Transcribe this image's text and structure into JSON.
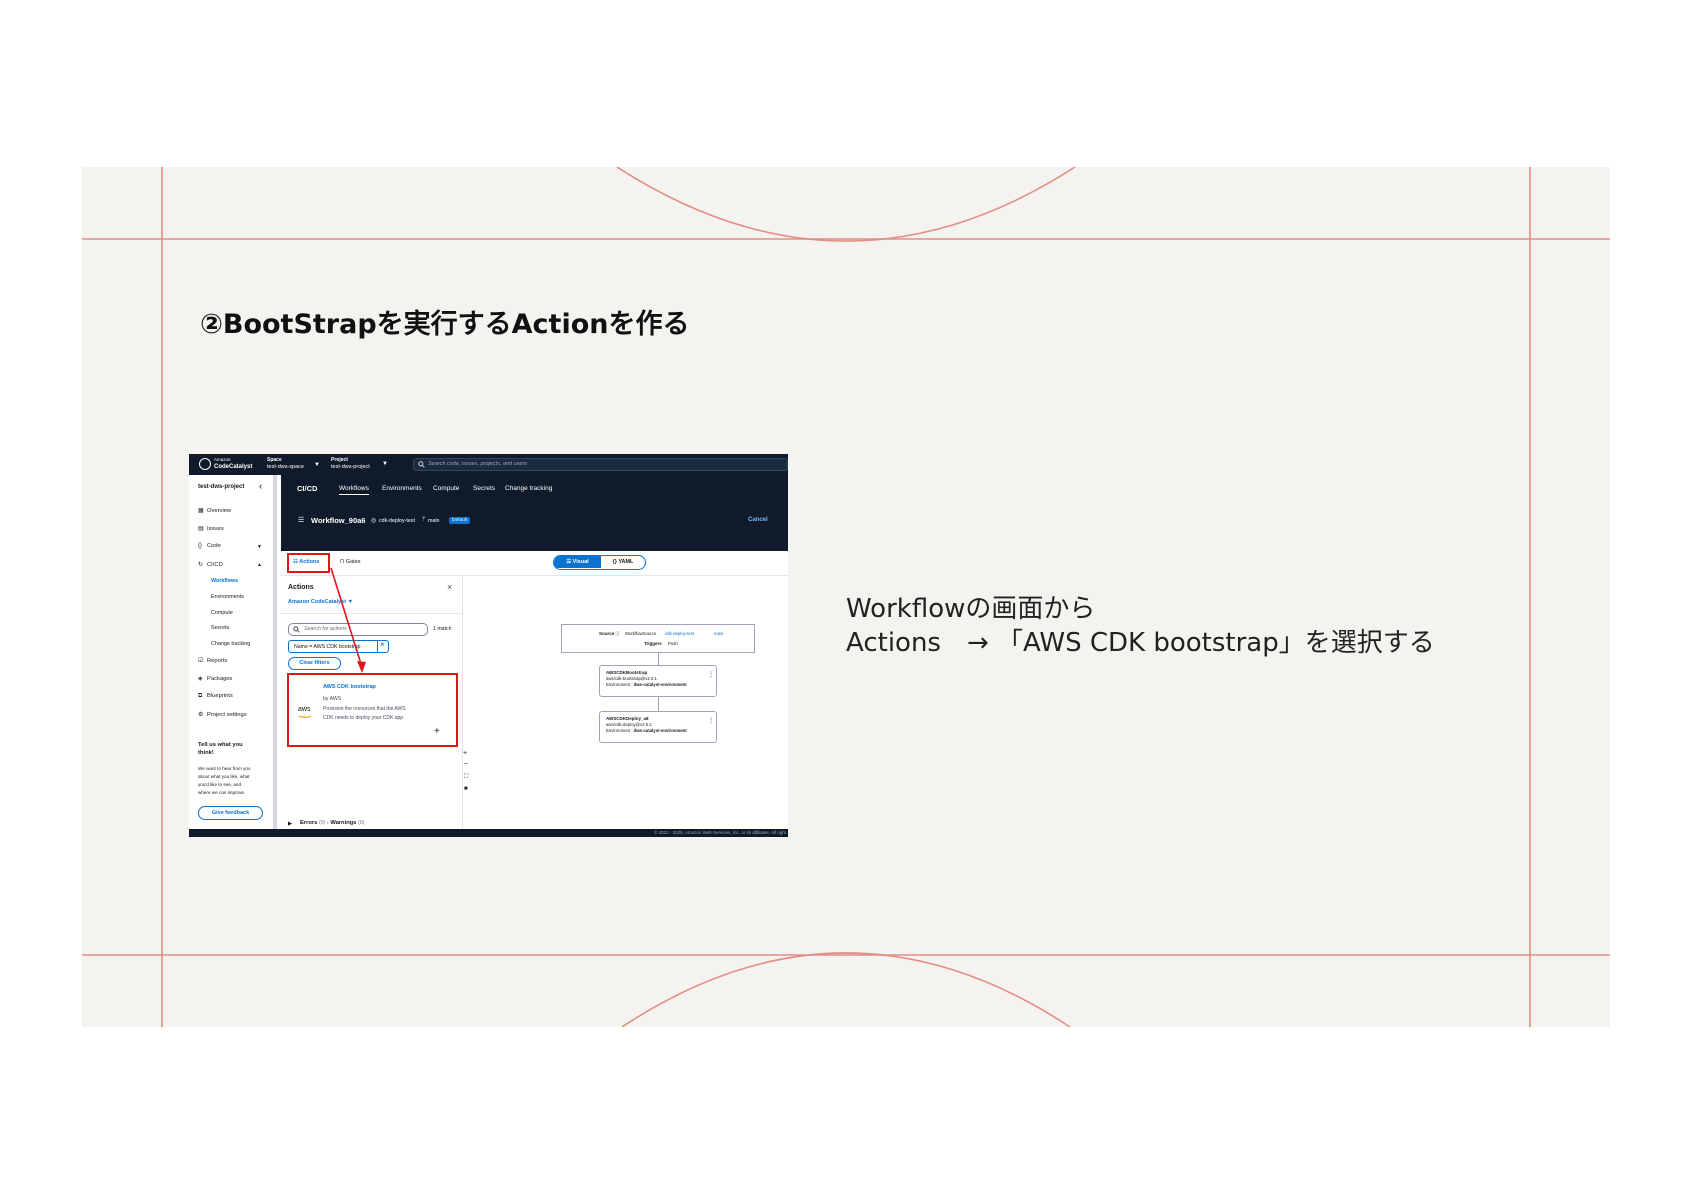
{
  "slide": {
    "title": "②BootStrapを実行するActionを作る",
    "desc_line1": "Workflowの画面から",
    "desc_line2": "Actions　→ 「AWS CDK bootstrap」を選択する"
  },
  "app": {
    "brand_small": "Amazon",
    "brand_name": "CodeCatalyst",
    "space_label": "Space",
    "space_value": "test-dws-space",
    "project_label": "Project",
    "project_value": "test-dws-project",
    "search_placeholder": "Search code, issues, projects, and users"
  },
  "sidebar": {
    "project_name": "test-dws-project",
    "items": [
      {
        "icon": "overview-icon",
        "label": "Overview"
      },
      {
        "icon": "issues-icon",
        "label": "Issues"
      },
      {
        "icon": "code-icon",
        "label": "Code"
      },
      {
        "icon": "cicd-icon",
        "label": "CI/CD"
      }
    ],
    "cicd_sub": [
      "Workflows",
      "Environments",
      "Compute",
      "Secrets",
      "Change tracking"
    ],
    "items2": [
      {
        "icon": "reports-icon",
        "label": "Reports"
      },
      {
        "icon": "packages-icon",
        "label": "Packages"
      },
      {
        "icon": "blueprints-icon",
        "label": "Blueprints"
      },
      {
        "icon": "settings-icon",
        "label": "Project settings"
      }
    ],
    "feedback_title": "Tell us what you think!",
    "feedback_text_1": "We want to hear from you",
    "feedback_text_2": "about what you like, what",
    "feedback_text_3": "you'd like to see, and",
    "feedback_text_4": "where we can improve.",
    "feedback_button": "Give feedback"
  },
  "header": {
    "section": "CI/CD",
    "tabs": [
      "Workflows",
      "Environments",
      "Compute",
      "Secrets",
      "Change tracking"
    ],
    "workflow_name": "Workflow_90a6",
    "repo": "cdk-deploy-test",
    "branch": "main",
    "badge": "Default",
    "cancel": "Cancel"
  },
  "toolbar": {
    "actions_tab": "Actions",
    "gates_tab": "Gates",
    "visual": "Visual",
    "yaml": "YAML"
  },
  "actions_panel": {
    "title": "Actions",
    "source": "Amazon CodeCatalyst",
    "search_placeholder": "Search for actions",
    "match_count": "1 match",
    "filter_chip": "Name = AWS CDK bootstrap",
    "clear_filters": "Clear filters",
    "result_title": "AWS CDK bootstrap",
    "result_by": "by AWS",
    "result_logo": "aws",
    "result_desc_1": "Provision the resources that the AWS",
    "result_desc_2": "CDK needs to deploy your CDK app.",
    "errors_label": "Errors",
    "errors_count": "(0)",
    "warnings_label": "- Warnings",
    "warnings_count": "(0)"
  },
  "workflow": {
    "source_label": "Source",
    "source_value": "WorkflowSource",
    "source_repo": "cdk-deploy-test",
    "source_branch": "main",
    "triggers_label": "Triggers",
    "triggers_value": "Push",
    "nodes": [
      {
        "name": "AWSCDKBootstrap",
        "action": "aws/cdk-bootstrap@v2.0.1",
        "env_label": "Environment :",
        "env": "dws-catalyst-environment"
      },
      {
        "name": "AWSCDKDeploy_a8",
        "action": "aws/cdk-deploy@v2.0.2",
        "env_label": "Environment :",
        "env": "dws-catalyst-environment"
      }
    ]
  },
  "footer": "© 2022 - 2025, Amazon Web Services, Inc. or its affiliates. All right",
  "colors": {
    "slide_bg": "#f5f3ef",
    "deco_line": "#e08f85",
    "highlight_red": "#e0161d",
    "app_dark": "#0f1b2a",
    "link_blue": "#0972d3"
  }
}
